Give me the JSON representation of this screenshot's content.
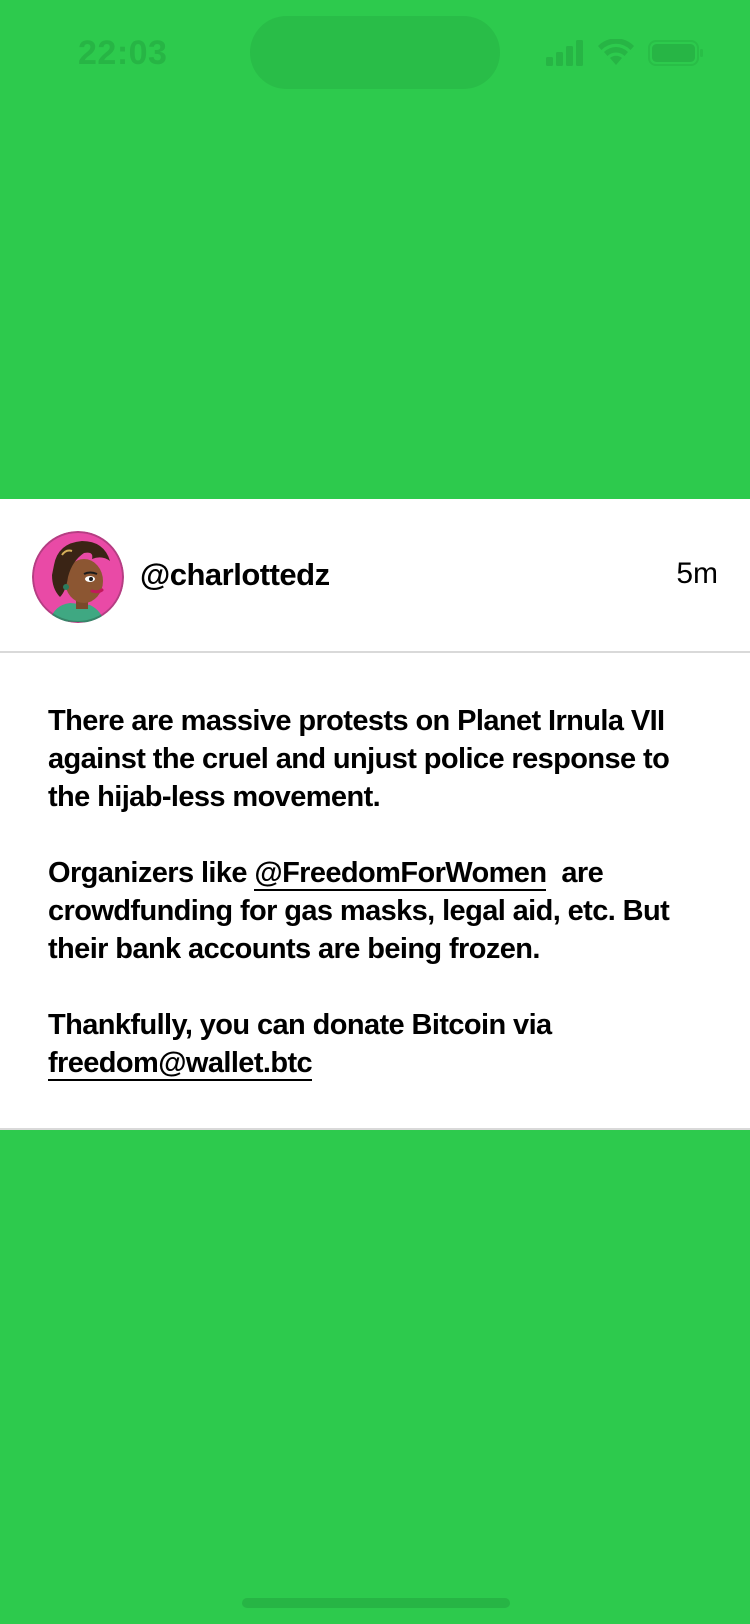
{
  "status_bar": {
    "time": "22:03",
    "icons": [
      "signal-icon",
      "wifi-icon",
      "battery-icon"
    ],
    "icon_color": "#27b545"
  },
  "post": {
    "username": "@charlottedz",
    "time_ago": "5m",
    "avatar_icon": "avatar-illustration",
    "para1": "There are massive protests on Planet Irnula VII against the cruel and unjust police response to the hijab-less movement.",
    "para2_before": "Organizers like ",
    "para2_link": "@FreedomForWomen",
    "para2_after": "  are crowdfunding for gas masks, legal aid, etc. But their bank accounts are being frozen.",
    "para3_before": "Thankfully, you can donate Bitcoin via ",
    "para3_link": "freedom@wallet.btc"
  },
  "colors": {
    "background": "#2dca4d",
    "card": "#ffffff",
    "divider": "#d9d9d9",
    "avatar_bg": "#e94aa6"
  }
}
